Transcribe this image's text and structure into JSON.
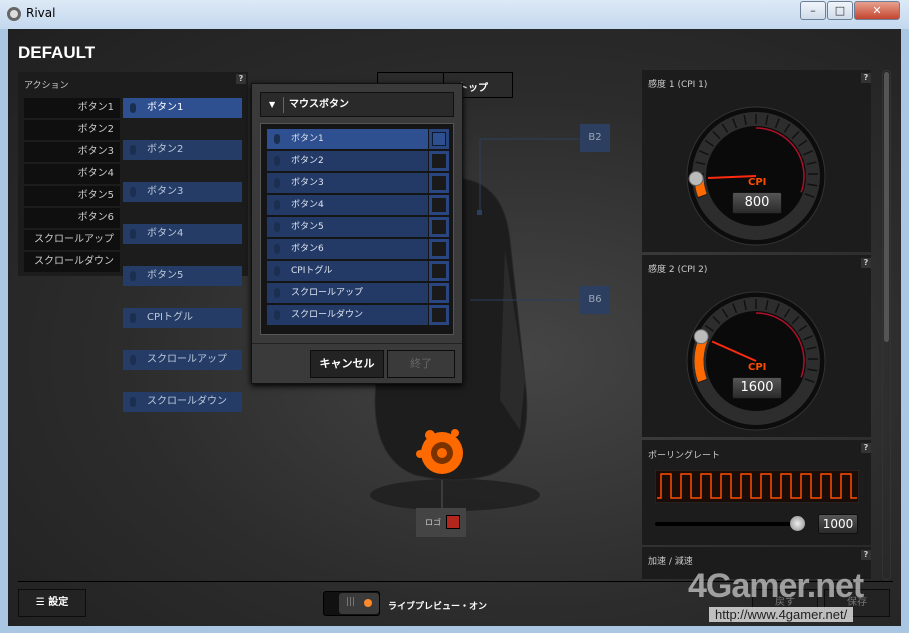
{
  "window": {
    "title": "Rival",
    "minimize": "–",
    "maximize": "□",
    "close": "✕"
  },
  "page_title": "DEFAULT",
  "actions": {
    "title": "アクション",
    "help": "?",
    "rows": [
      {
        "button": "ボタン1",
        "action": "ボタン1"
      },
      {
        "button": "ボタン2",
        "action": "ボタン2"
      },
      {
        "button": "ボタン3",
        "action": "ボタン3"
      },
      {
        "button": "ボタン4",
        "action": "ボタン4"
      },
      {
        "button": "ボタン5",
        "action": "ボタン5"
      },
      {
        "button": "ボタン6",
        "action": "CPIトグル"
      },
      {
        "button": "スクロールアップ",
        "action": "スクロールアップ"
      },
      {
        "button": "スクロールダウン",
        "action": "スクロールダウン"
      }
    ]
  },
  "popup": {
    "dropdown": "マウスボタン",
    "items": [
      "ボタン1",
      "ボタン2",
      "ボタン3",
      "ボタン4",
      "ボタン5",
      "ボタン6",
      "CPIトグル",
      "スクロールアップ",
      "スクロールダウン"
    ],
    "selected_index": 0,
    "cancel": "キャンセル",
    "done": "終了"
  },
  "view_tabs": {
    "right": "トップ"
  },
  "mouse": {
    "tags": {
      "b2": "B2",
      "b6": "B6"
    },
    "logo_label": "ロゴ",
    "logo_color": "#b3261e"
  },
  "sensitivity1": {
    "title": "感度 1 (CPI 1)",
    "label": "CPI",
    "value": "800",
    "help": "?"
  },
  "sensitivity2": {
    "title": "感度 2 (CPI 2)",
    "label": "CPI",
    "value": "1600",
    "help": "?"
  },
  "polling": {
    "title": "ポーリングレート",
    "value": "1000",
    "help": "?",
    "slider_fraction": 1.0
  },
  "accel": {
    "title": "加速 / 減速",
    "help": "?"
  },
  "footer": {
    "settings": "設定",
    "live_preview": "ライブプレビュー・オン",
    "revert": "戻す",
    "save": "保存"
  },
  "watermark": {
    "brand": "4Gamer.net",
    "url": "http://www.4gamer.net/"
  },
  "colors": {
    "accent": "#ff6a00",
    "blue": "#2e5090"
  }
}
